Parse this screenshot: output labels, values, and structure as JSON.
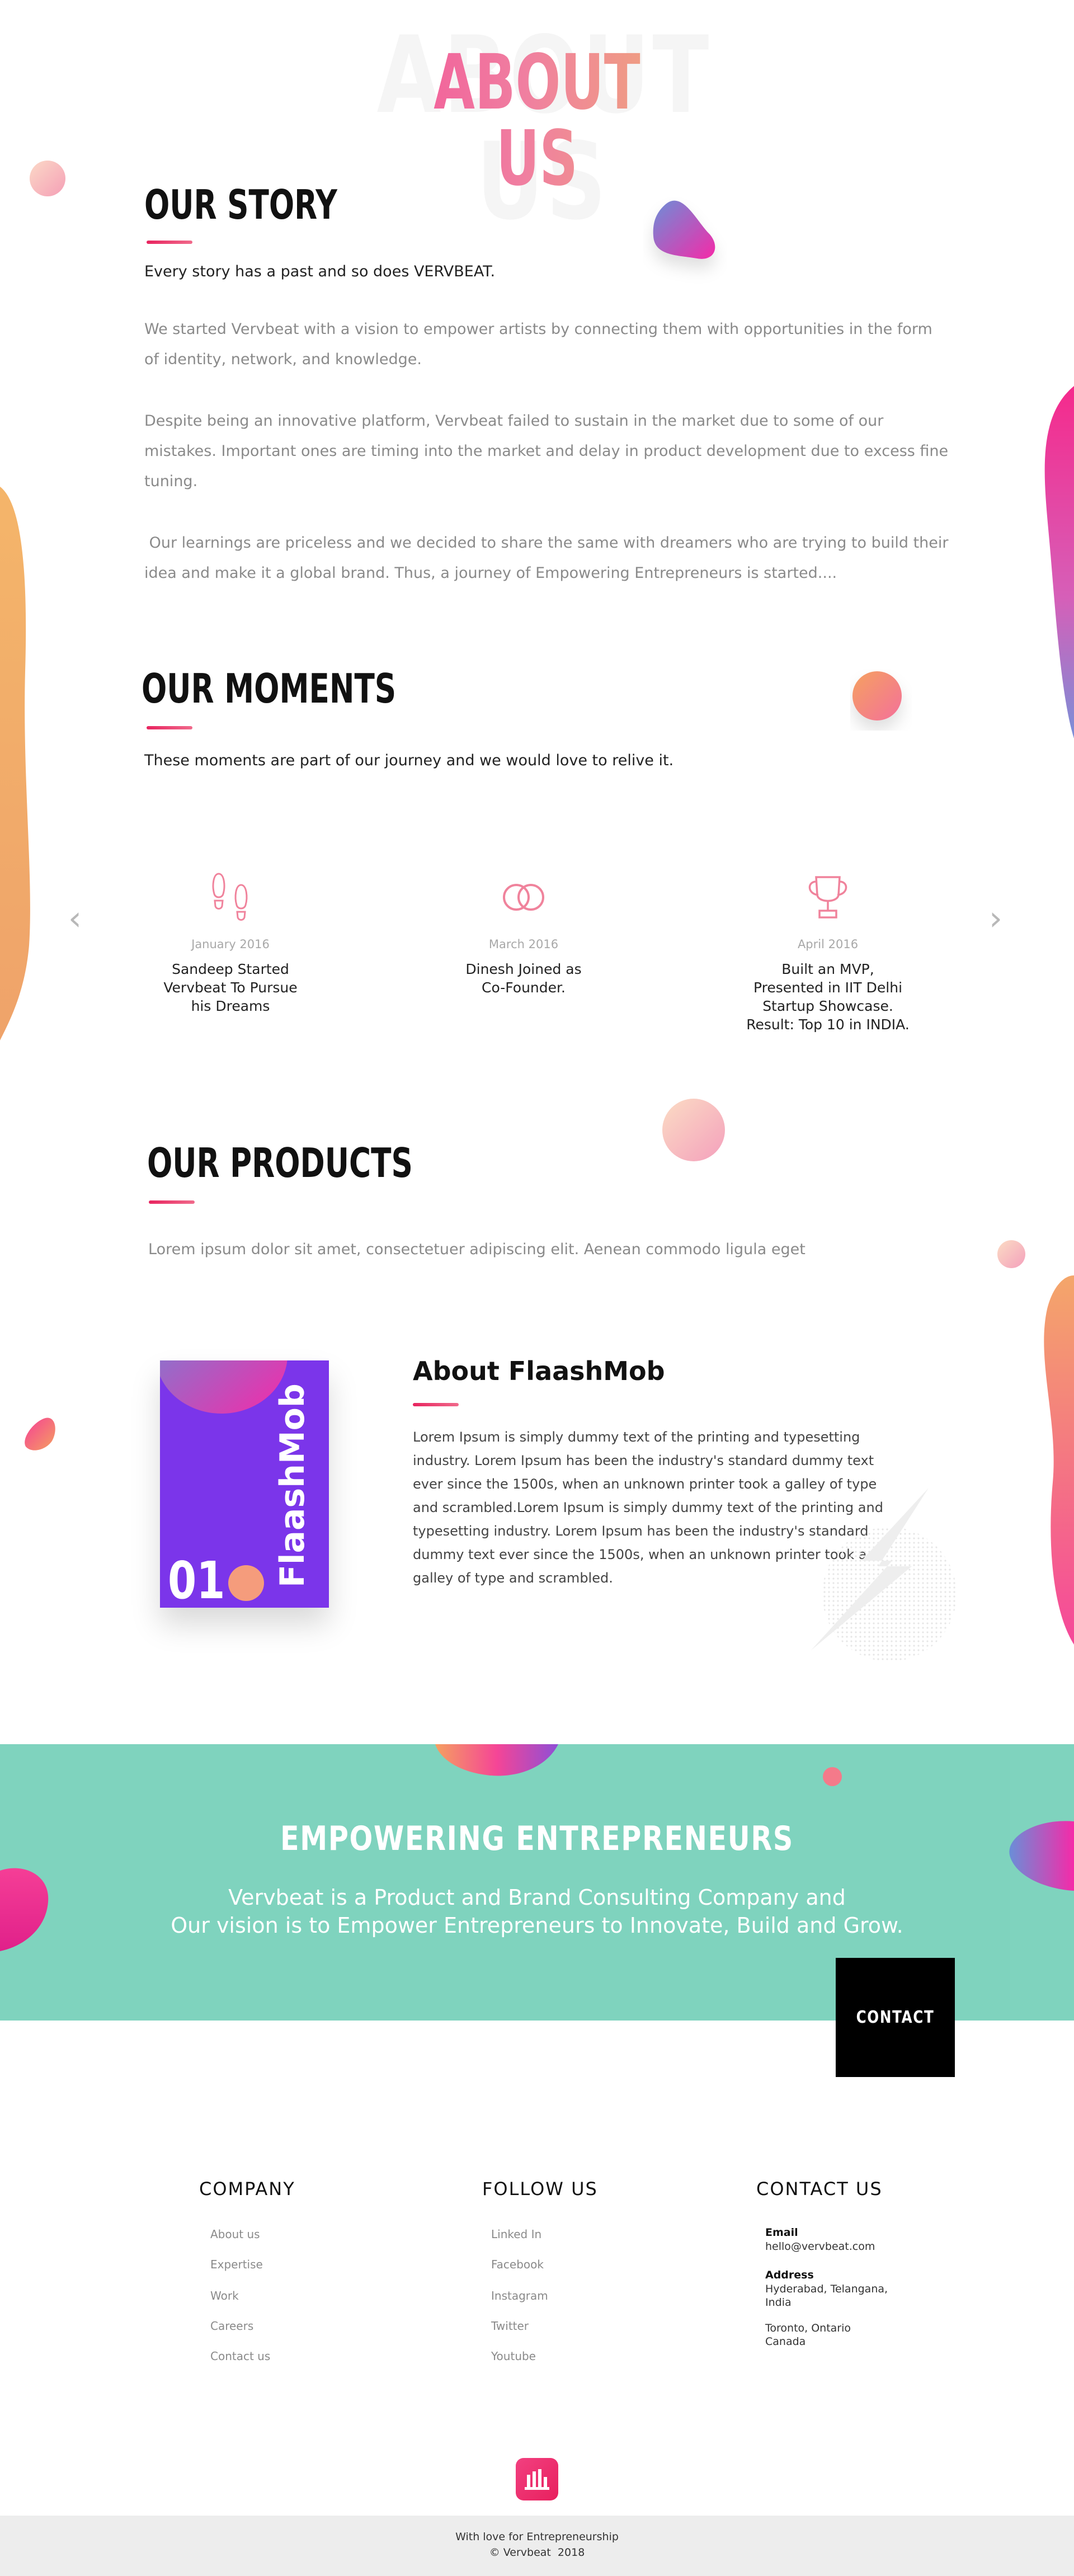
{
  "hero": {
    "background_text": "ABOUT US",
    "title": "ABOUT US"
  },
  "story": {
    "title": "OUR STORY",
    "lead": "Every story has a past and so does VERVBEAT.",
    "paragraphs": [
      "We started Vervbeat with a vision to empower artists by connecting them with opportunities in the form of identity, network, and knowledge.",
      "Despite being an innovative platform, Vervbeat failed to sustain in the market due to some of our mistakes. Important ones are timing into the market and delay in product development due to excess fine tuning.",
      " Our learnings are priceless and we decided to share the same with dreamers who are trying to build their idea and make it a global brand. Thus, a journey of Empowering Entrepreneurs is started...."
    ]
  },
  "moments": {
    "title": "OUR MOMENTS",
    "lead": "These moments are part of our journey and we would love to relive it.",
    "items": [
      {
        "icon": "footprints-icon",
        "date": "January 2016",
        "desc_lines": [
          "Sandeep Started",
          "Vervbeat To Pursue",
          "his Dreams"
        ]
      },
      {
        "icon": "rings-icon",
        "date": "March 2016",
        "desc_lines": [
          "Dinesh Joined as",
          "Co-Founder."
        ]
      },
      {
        "icon": "trophy-icon",
        "date": "April 2016",
        "desc_lines": [
          "Built an MVP,",
          "Presented in IIT Delhi",
          "Startup Showcase.",
          "Result: Top 10 in INDIA."
        ]
      }
    ],
    "prev_arrow": "‹",
    "next_arrow": "›"
  },
  "products": {
    "title": "OUR PRODUCTS",
    "lead": "Lorem ipsum dolor sit amet, consectetuer adipiscing elit. Aenean commodo ligula eget",
    "card": {
      "number": "01",
      "name": "FlaashMob",
      "color": "#7b35ea"
    },
    "about_title": "About FlaashMob",
    "about_lines": [
      "Lorem Ipsum is simply dummy text of the printing and typesetting",
      "industry. Lorem Ipsum has been the industry's standard dummy text",
      "ever since the 1500s, when an unknown printer took a galley of type",
      "and scrambled.Lorem Ipsum is simply dummy text of the printing and",
      "typesetting industry. Lorem Ipsum has been the industry's standard",
      "dummy text ever since the 1500s, when an unknown printer took a",
      "galley of type and scrambled."
    ]
  },
  "banner": {
    "title": "EMPOWERING ENTREPRENEURS",
    "line1": "Vervbeat is a Product and Brand Consulting Company and",
    "line2": "Our vision is to Empower Entrepreneurs to Innovate, Build and Grow.",
    "button": "CONTACT US",
    "color": "#7fd3be"
  },
  "footer": {
    "company": {
      "heading": "COMPANY",
      "links": [
        "About us",
        "Expertise",
        "Work",
        "Careers",
        "Contact us"
      ]
    },
    "follow": {
      "heading": "FOLLOW US",
      "links": [
        "Linked In",
        "Facebook",
        "Instagram",
        "Twitter",
        "Youtube"
      ]
    },
    "contact": {
      "heading": "CONTACT US",
      "email_label": "Email",
      "email": "hello@vervbeat.com",
      "address_label": "Address",
      "address_lines": [
        "Hyderabad, Telangana,",
        "India"
      ],
      "address2_lines": [
        "Toronto, Ontario",
        "Canada"
      ]
    },
    "love": "With love for Entrepreneurship",
    "copyright": "© Vervbeat  2018",
    "logo_color": "#f0286a"
  },
  "colors": {
    "accent": "#e8245f",
    "gradient_pink": "#f2609b",
    "gradient_peach": "#efa17f"
  }
}
